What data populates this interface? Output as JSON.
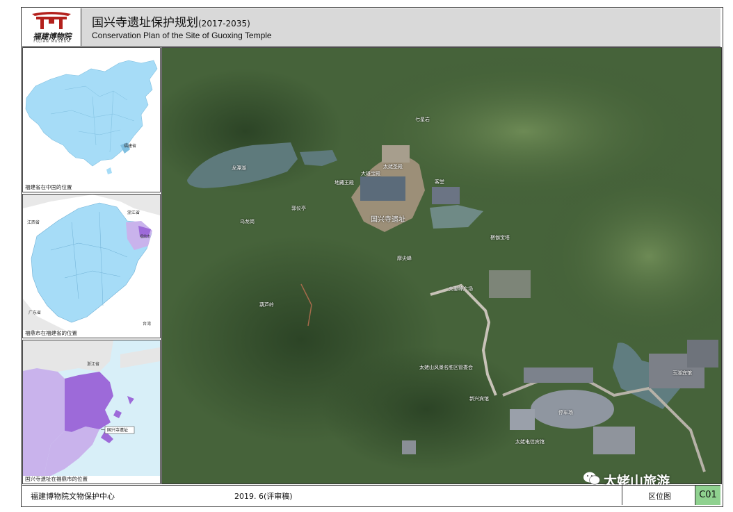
{
  "header": {
    "title_cn": "国兴寺遗址保护规划",
    "title_years": "(2017-2035)",
    "title_en": "Conservation Plan of the Site of Guoxing Temple",
    "logo_text": "福建博物院",
    "logo_sub": "FUJIAN MUSEUM"
  },
  "insets": [
    {
      "caption": "福建省在中国的位置",
      "labels": [
        "福建省"
      ]
    },
    {
      "caption": "福鼎市在福建省的位置",
      "labels": [
        "江西省",
        "浙江省",
        "广东省",
        "台湾",
        "福鼎市"
      ]
    },
    {
      "caption": "国兴寺遗址在福鼎市的位置",
      "labels": [
        "浙江省",
        "国兴寺遗址"
      ]
    }
  ],
  "main_map": {
    "site_label": "国兴寺遗址",
    "labels": [
      "七星岩",
      "龙潭湖",
      "太姥圣殿",
      "大雄宝殿",
      "地藏王殿",
      "客堂",
      "郭仪亭",
      "乌龙岗",
      "楞伽宝塔",
      "摩尖峰",
      "夫妻峰广场",
      "葫芦岭",
      "太姥山风景名胜区管委会",
      "新兴宾馆",
      "停车场",
      "玉湖宾馆",
      "太姥电信宾馆"
    ]
  },
  "footer": {
    "org": "福建博物院文物保护中心",
    "date": "2019. 6(评审稿)",
    "drawing_name": "区位图",
    "code": "C01"
  },
  "watermark": "太姥山旅游",
  "colors": {
    "header_bg": "#d9d9d9",
    "code_bg": "#8fd18f",
    "province": "#a6dcf7",
    "highlight": "#9d6ad9"
  }
}
